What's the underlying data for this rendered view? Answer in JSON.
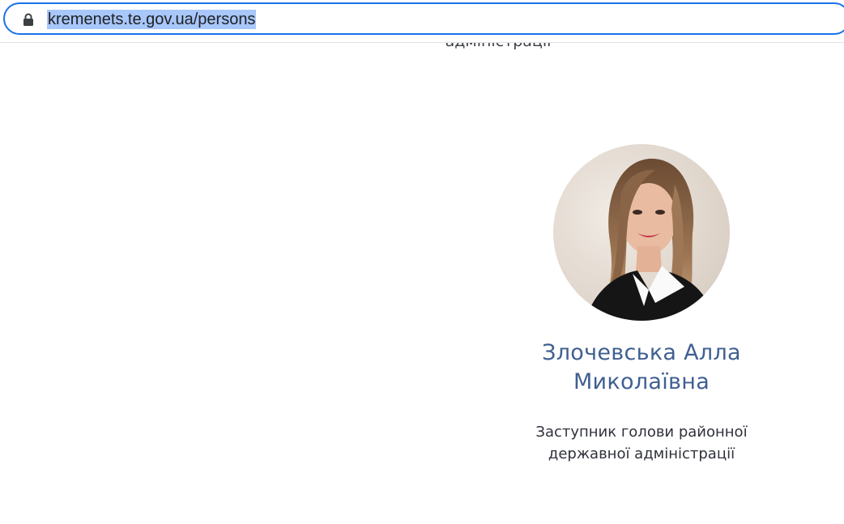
{
  "browser": {
    "url": "kremenets.te.gov.ua/persons",
    "icons": {
      "security": "lock-icon"
    }
  },
  "previous_person": {
    "position_tail": "адміністрації"
  },
  "person": {
    "name_line1": "Злочевська Алла",
    "name_line2": "Миколаївна",
    "position_line1": "Заступник голови районної",
    "position_line2": "державної адміністрації"
  },
  "colors": {
    "name": "#3f5f91",
    "text": "#2f323a",
    "url_highlight": "#a8c7fa",
    "omnibox_border": "#1a73e8"
  }
}
